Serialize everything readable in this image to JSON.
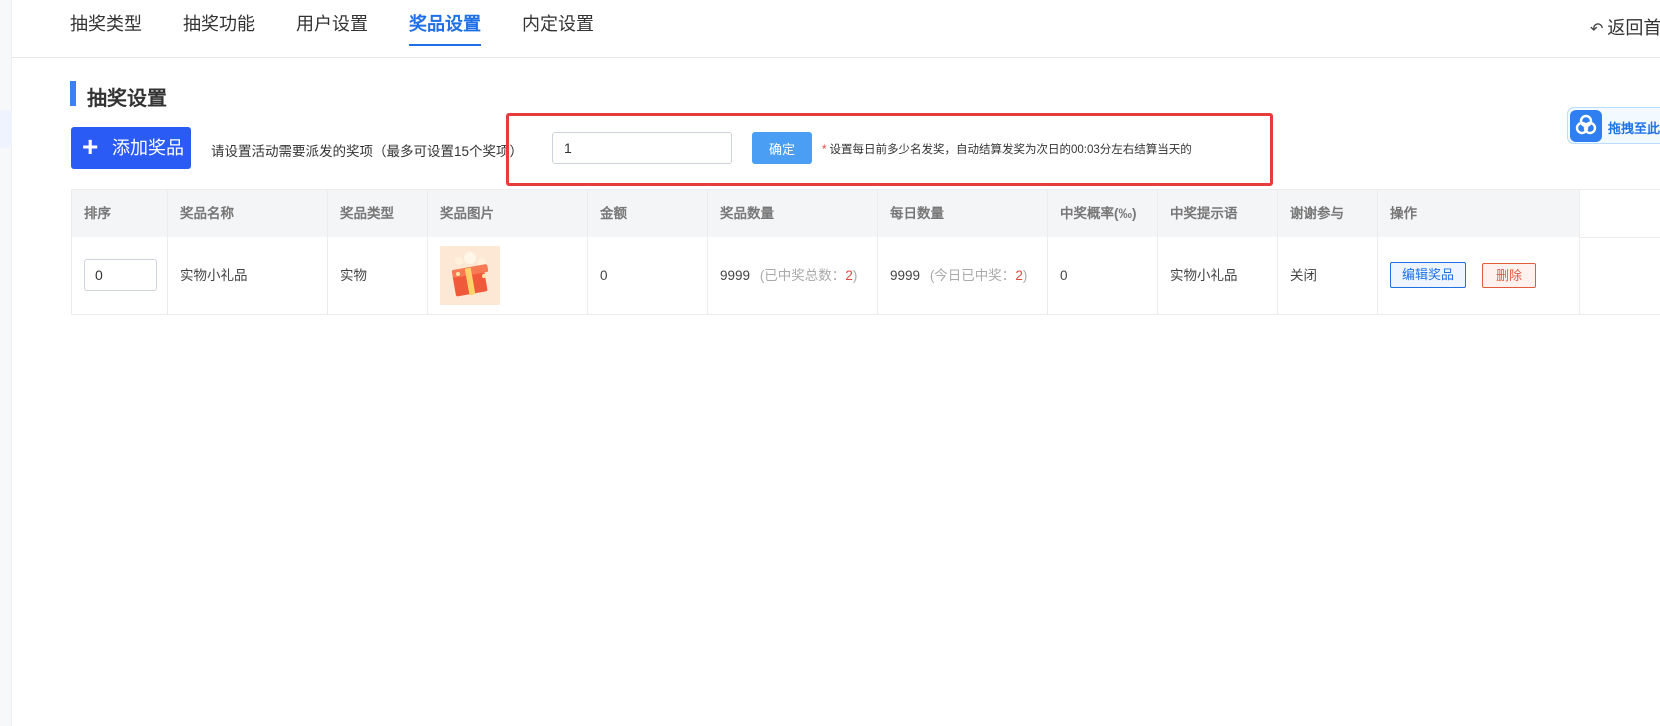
{
  "nav": {
    "tabs": [
      {
        "label": "抽奖类型"
      },
      {
        "label": "抽奖功能"
      },
      {
        "label": "用户设置"
      },
      {
        "label": "奖品设置"
      },
      {
        "label": "内定设置"
      }
    ],
    "active_tab": "奖品设置",
    "back_label": "返回首页"
  },
  "section": {
    "title": "抽奖设置"
  },
  "toolbar": {
    "add_label": "添加奖品",
    "hint": "请设置活动需要派发的奖项（最多可设置15个奖项）",
    "daily_winners_value": "1",
    "confirm_label": "确定",
    "note_star": "*",
    "note": "设置每日前多少名发奖，自动结算发奖为次日的00:03分左右结算当天的",
    "drag_label": "拖拽至此"
  },
  "table": {
    "headers": [
      "排序",
      "奖品名称",
      "奖品类型",
      "奖品图片",
      "金额",
      "奖品数量",
      "每日数量",
      "中奖概率(‰)",
      "中奖提示语",
      "谢谢参与",
      "操作"
    ],
    "rows": [
      {
        "sort": "0",
        "name": "实物小礼品",
        "type": "实物",
        "image_icon": "gift-box-image",
        "amount": "0",
        "quantity": "9999",
        "quantity_note_prefix": "(已中奖总数：",
        "quantity_won": "2",
        "quantity_note_suffix": ")",
        "daily": "9999",
        "daily_note_prefix": "(今日已中奖：",
        "daily_won": "2",
        "daily_note_suffix": ")",
        "probability": "0",
        "tip": "实物小礼品",
        "thanks": "关闭",
        "edit_label": "编辑奖品",
        "delete_label": "删除"
      }
    ]
  },
  "colors": {
    "primary": "#1e6fe8",
    "add_button": "#2a5bf5",
    "confirm_button": "#4a9ff5",
    "highlight_border": "#e83b3b",
    "danger": "#e55a3c"
  }
}
